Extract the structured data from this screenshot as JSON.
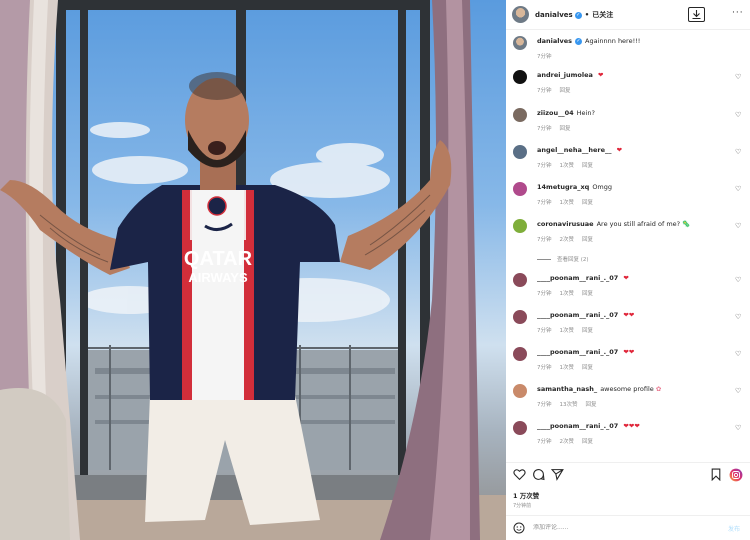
{
  "header": {
    "username": "danialves",
    "verified_glyph": "✓",
    "separator": "•",
    "follow_label": "已关注",
    "download_icon": "download-icon",
    "more_icon": "more-horizontal-icon"
  },
  "caption": {
    "username": "danialves",
    "text": "Againnnn here!!!",
    "time": "7分钟"
  },
  "comments": [
    {
      "username": "andrei_jumolea",
      "text": "",
      "emoji": "❤",
      "emoji_class": "heart",
      "time": "7分钟",
      "likes": "",
      "reply": "回复"
    },
    {
      "username": "ziizou__04",
      "text": "Hein?",
      "emoji": "",
      "emoji_class": "",
      "time": "7分钟",
      "likes": "",
      "reply": "回复"
    },
    {
      "username": "angel__neha__here__",
      "text": "",
      "emoji": "❤",
      "emoji_class": "heart",
      "time": "7分钟",
      "likes": "1次赞",
      "reply": "回复"
    },
    {
      "username": "14metugra_xq",
      "text": "Omgg",
      "emoji": "",
      "emoji_class": "",
      "time": "7分钟",
      "likes": "1次赞",
      "reply": "回复"
    },
    {
      "username": "coronavirusuae",
      "text": "Are you still afraid of me?",
      "emoji": "🦠",
      "emoji_class": "emoji-ring",
      "time": "7分钟",
      "likes": "2次赞",
      "reply": "回复"
    },
    {
      "username": "____poonam__rani_._07",
      "text": "",
      "emoji": "❤",
      "emoji_class": "heart",
      "time": "7分钟",
      "likes": "1次赞",
      "reply": "回复"
    },
    {
      "username": "____poonam__rani_._07",
      "text": "",
      "emoji": "❤❤",
      "emoji_class": "heart",
      "time": "7分钟",
      "likes": "1次赞",
      "reply": "回复"
    },
    {
      "username": "____poonam__rani_._07",
      "text": "",
      "emoji": "❤❤",
      "emoji_class": "heart",
      "time": "7分钟",
      "likes": "1次赞",
      "reply": "回复"
    },
    {
      "username": "samantha_nash_",
      "text": "awesome profile",
      "emoji": "✿",
      "emoji_class": "emoji-f",
      "time": "7分钟",
      "likes": "13次赞",
      "reply": "回复"
    },
    {
      "username": "____poonam__rani_._07",
      "text": "",
      "emoji": "❤❤❤",
      "emoji_class": "heart",
      "time": "7分钟",
      "likes": "2次赞",
      "reply": "回复"
    }
  ],
  "view_replies": "查看回复 (2)",
  "like_glyph": "♡",
  "actions": {
    "icons": [
      "heart-icon",
      "comment-icon",
      "share-icon",
      "bookmark-icon",
      "instagram-icon"
    ],
    "likes": "1 万次赞",
    "time": "7分钟前"
  },
  "add_comment": {
    "placeholder": "添加评论......",
    "post_label": "发布"
  },
  "colors": {
    "link_blue": "#3897f0",
    "heart_red": "#e0263a",
    "jersey_navy": "#1b2447",
    "jersey_red": "#d22e3a"
  }
}
